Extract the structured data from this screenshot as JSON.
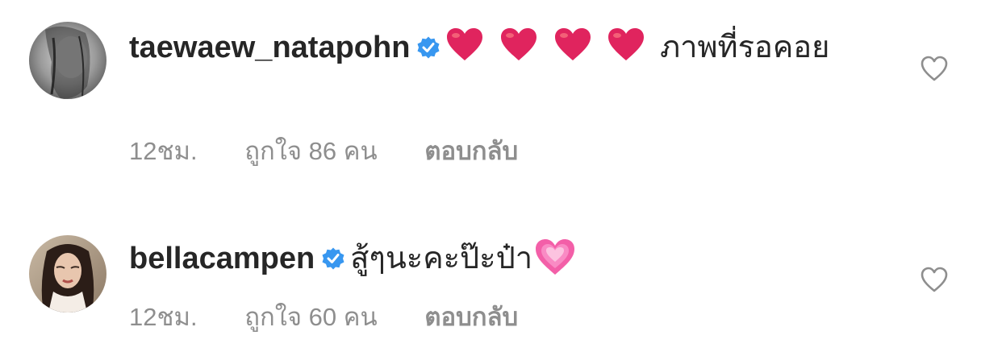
{
  "comments": [
    {
      "username": "taewaew_natapohn",
      "verified": true,
      "emoji": [
        "red-heart",
        "red-heart",
        "red-heart",
        "red-heart"
      ],
      "text": "ภาพที่รอคอย",
      "time": "12ชม.",
      "likes": "ถูกใจ 86 คน",
      "reply": "ตอบกลับ",
      "avatar": "grayscale-portrait"
    },
    {
      "username": "bellacampen",
      "verified": true,
      "text": "สู้ๆนะคะป๊ะป๋า",
      "emoji_after": "growing-heart",
      "time": "12ชม.",
      "likes": "ถูกใจ 60 คน",
      "reply": "ตอบกลับ",
      "avatar": "color-portrait"
    }
  ],
  "colors": {
    "text": "#262626",
    "meta": "#8e8e8e",
    "verified": "#3897f0",
    "heart_red": "#e0245e",
    "heart_pink": "#f35fa8"
  }
}
